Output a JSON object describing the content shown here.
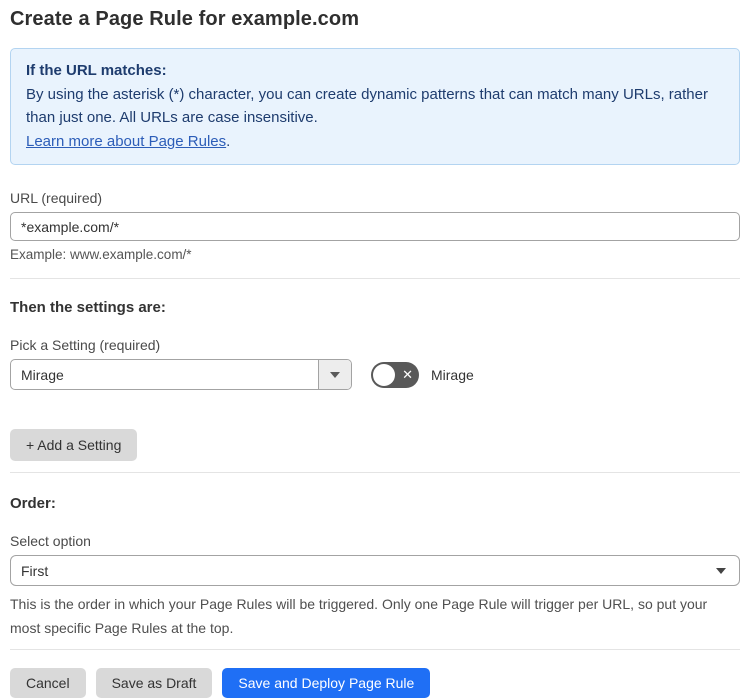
{
  "page": {
    "title": "Create a Page Rule for example.com"
  },
  "info_box": {
    "heading": "If the URL matches:",
    "body": "By using the asterisk (*) character, you can create dynamic patterns that can match many URLs, rather than just one. All URLs are case insensitive.",
    "link_text": "Learn more about Page Rules",
    "link_suffix": "."
  },
  "url_field": {
    "label": "URL (required)",
    "value": "*example.com/*",
    "helper": "Example: www.example.com/*"
  },
  "settings_section": {
    "heading": "Then the settings are:",
    "picker_label": "Pick a Setting (required)",
    "picker_value": "Mirage",
    "toggle": {
      "label": "Mirage",
      "state": "off",
      "x_glyph": "✕"
    },
    "add_button_label": "+ Add a Setting"
  },
  "order_section": {
    "heading": "Order:",
    "select_label": "Select option",
    "select_value": "First",
    "helper": "This is the order in which your Page Rules will be triggered. Only one Page Rule will trigger per URL, so put your most specific Page Rules at the top."
  },
  "footer": {
    "cancel_label": "Cancel",
    "save_draft_label": "Save as Draft",
    "save_deploy_label": "Save and Deploy Page Rule"
  },
  "colors": {
    "info_box_bg": "#e9f3fd",
    "info_box_border": "#b3d4f1",
    "info_box_text": "#1e3c6e",
    "link": "#2c5db8",
    "primary_button": "#1f6ff5",
    "secondary_button": "#d9d9d9",
    "toggle_off": "#595959",
    "input_border": "#a3a3a3"
  },
  "icons": {
    "select_arrow": "dropdown-caret-down",
    "toggle_off_icon": "x-mark"
  }
}
